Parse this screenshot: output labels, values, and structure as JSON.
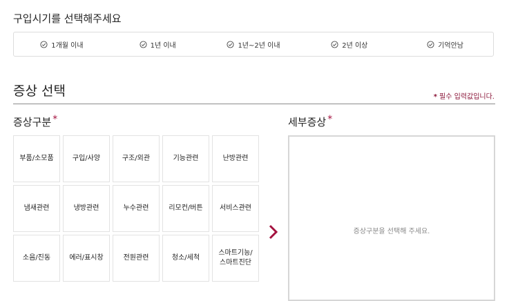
{
  "purchase_period": {
    "title": "구입시기를 선택해주세요",
    "options": [
      {
        "label": "1개월 이내"
      },
      {
        "label": "1년 이내"
      },
      {
        "label": "1년~2년 이내"
      },
      {
        "label": "2년 이상"
      },
      {
        "label": "기억안남"
      }
    ]
  },
  "symptom": {
    "title": "증상 선택",
    "required_star": "*",
    "required_note": "필수 입력값입니다."
  },
  "category": {
    "title": "증상구분",
    "star": "*",
    "items": [
      "부품/소모품",
      "구입/사양",
      "구조/외관",
      "기능관련",
      "난방관련",
      "냄새관련",
      "냉방관련",
      "누수관련",
      "리모컨/버튼",
      "서비스관련",
      "소음/진동",
      "에러/표시창",
      "전원관련",
      "청소/세척",
      "스마트기능/스마트진단"
    ]
  },
  "detail": {
    "title": "세부증상",
    "star": "*",
    "placeholder": "증상구분을 선택해 주세요."
  },
  "colors": {
    "accent": "#a4123f",
    "note": "#8a1538",
    "border": "#dcdcdc"
  }
}
